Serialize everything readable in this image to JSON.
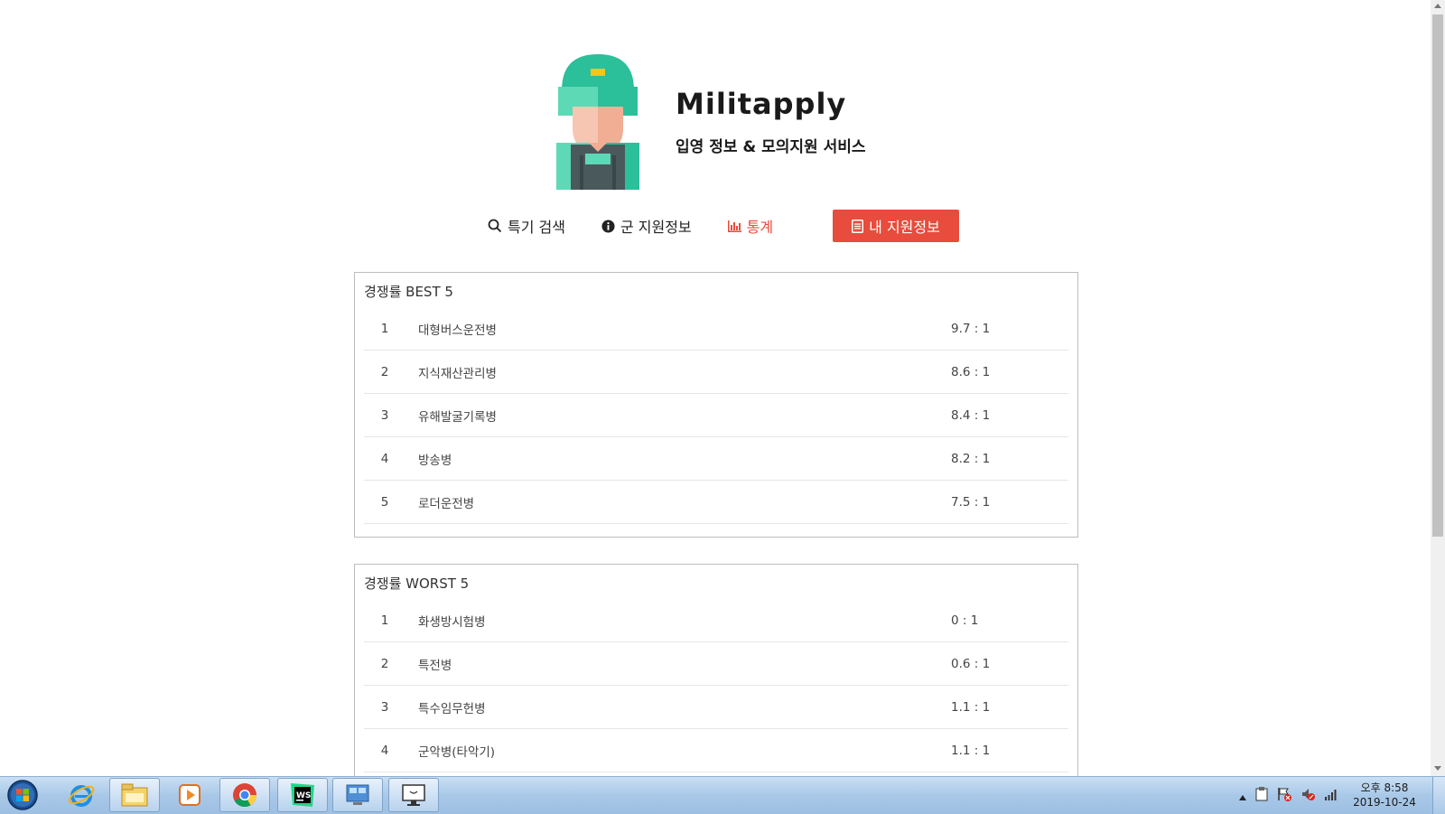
{
  "brand": {
    "title": "Militapply",
    "subtitle": "입영 정보 & 모의지원 서비스"
  },
  "nav": {
    "items": [
      {
        "label": "특기 검색",
        "icon": "search-icon"
      },
      {
        "label": "군 지원정보",
        "icon": "info-icon"
      },
      {
        "label": "통계",
        "icon": "bar-chart-icon"
      }
    ],
    "button_label": "내 지원정보",
    "button_icon": "document-icon"
  },
  "best": {
    "title": "경쟁률 BEST 5",
    "rows": [
      {
        "rank": "1",
        "name": "대형버스운전병",
        "ratio": "9.7 : 1"
      },
      {
        "rank": "2",
        "name": "지식재산관리병",
        "ratio": "8.6 : 1"
      },
      {
        "rank": "3",
        "name": "유해발굴기록병",
        "ratio": "8.4 : 1"
      },
      {
        "rank": "4",
        "name": "방송병",
        "ratio": "8.2 : 1"
      },
      {
        "rank": "5",
        "name": "로더운전병",
        "ratio": "7.5 : 1"
      }
    ]
  },
  "worst": {
    "title": "경쟁률 WORST 5",
    "rows": [
      {
        "rank": "1",
        "name": "화생방시험병",
        "ratio": "0 : 1"
      },
      {
        "rank": "2",
        "name": "특전병",
        "ratio": "0.6 : 1"
      },
      {
        "rank": "3",
        "name": "특수임무헌병",
        "ratio": "1.1 : 1"
      },
      {
        "rank": "4",
        "name": "군악병(타악기)",
        "ratio": "1.1 : 1"
      }
    ]
  },
  "taskbar": {
    "apps": [
      "start-orb",
      "internet-explorer",
      "file-explorer",
      "media-player",
      "chrome",
      "webstorm",
      "control-panel",
      "remote-desktop"
    ],
    "clock_time": "오후 8:58",
    "clock_date": "2019-10-24"
  },
  "colors": {
    "accent": "#e74c3c",
    "logo_green": "#2bbf9a",
    "logo_dark": "#4a5a5c"
  }
}
